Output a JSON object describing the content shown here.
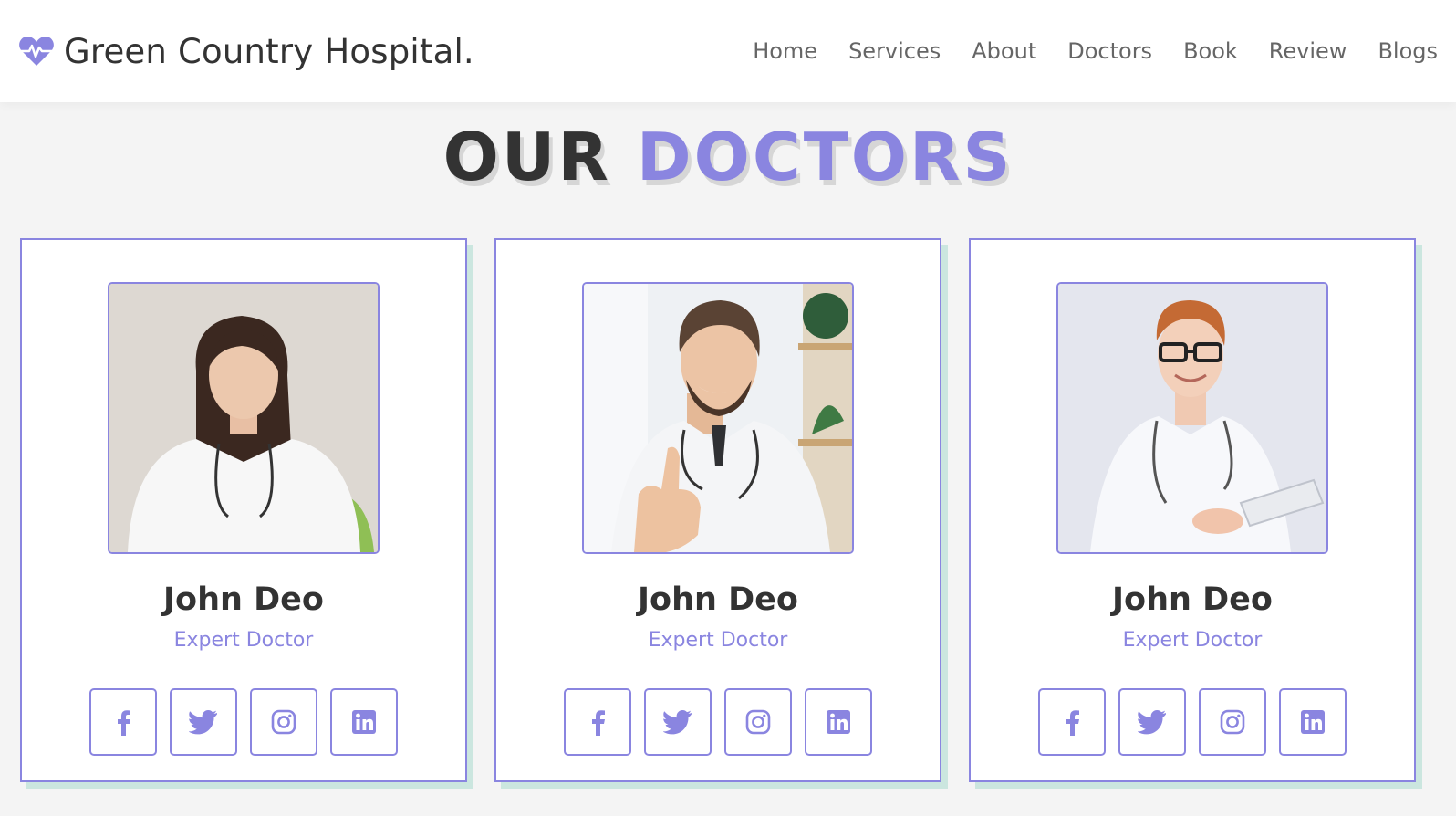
{
  "brand": {
    "name": "Green Country Hospital.",
    "icon": "heartbeat-icon",
    "accent_color": "#8a85e0",
    "shadow_color": "#cbe6df"
  },
  "nav": {
    "items": [
      {
        "label": "Home"
      },
      {
        "label": "Services"
      },
      {
        "label": "About"
      },
      {
        "label": "Doctors"
      },
      {
        "label": "Book"
      },
      {
        "label": "Review"
      },
      {
        "label": "Blogs"
      }
    ]
  },
  "section": {
    "heading_part1": "OUR",
    "heading_part2": "DOCTORS"
  },
  "doctors": [
    {
      "name": "John Deo",
      "title": "Expert Doctor"
    },
    {
      "name": "John Deo",
      "title": "Expert Doctor"
    },
    {
      "name": "John Deo",
      "title": "Expert Doctor"
    }
  ],
  "social_icons": [
    "facebook-icon",
    "twitter-icon",
    "instagram-icon",
    "linkedin-icon"
  ]
}
